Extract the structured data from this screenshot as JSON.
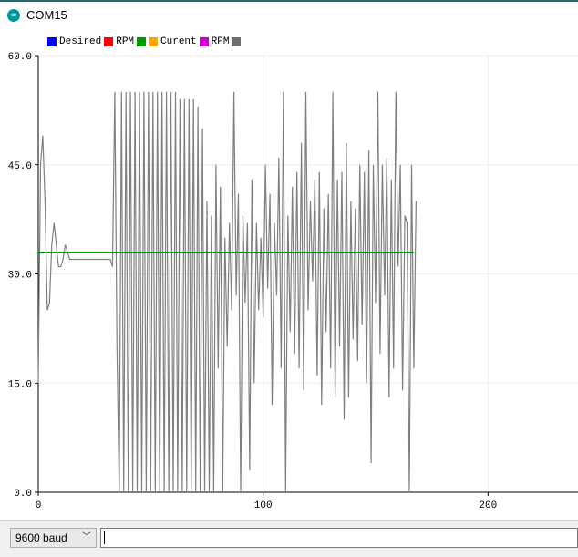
{
  "window": {
    "title": "COM15",
    "icon": "arduino-infinity-icon"
  },
  "legend": [
    {
      "label": "Desired",
      "color": "#0000ff"
    },
    {
      "label": "RPM",
      "color": "#ff0000"
    },
    {
      "label": "Curent",
      "color": "#009900"
    },
    {
      "label": "RPM",
      "color": "#cc00cc"
    },
    {
      "label": "",
      "color": "#ffa500"
    },
    {
      "label": "",
      "color": "#6e6e6e"
    }
  ],
  "chart_data": {
    "type": "line",
    "x_ticks": [
      "0",
      "100",
      "200"
    ],
    "y_ticks": [
      "0.0",
      "15.0",
      "30.0",
      "45.0",
      "60.0"
    ],
    "xlim": [
      0,
      240
    ],
    "ylim": [
      0,
      60
    ],
    "grid": true,
    "series": [
      {
        "color": "#808080",
        "x_start": 0,
        "values": [
          15,
          45,
          49,
          40,
          25,
          26,
          34,
          37,
          34,
          31,
          31,
          32,
          34,
          33,
          32,
          32,
          32,
          32,
          32,
          32,
          32,
          32,
          32,
          32,
          32,
          32,
          32,
          32,
          32,
          32,
          32,
          32,
          32,
          31,
          55,
          20,
          0,
          55,
          0,
          55,
          0,
          55,
          0,
          55,
          0,
          55,
          0,
          55,
          0,
          55,
          0,
          55,
          0,
          55,
          0,
          55,
          0,
          55,
          0,
          55,
          0,
          55,
          0,
          54,
          0,
          54,
          0,
          54,
          0,
          54,
          0,
          53,
          0,
          50,
          0,
          40,
          0,
          38,
          0,
          45,
          17,
          42,
          0,
          35,
          20,
          37,
          25,
          55,
          27,
          41,
          0,
          38,
          26,
          37,
          3,
          43,
          15,
          37,
          25,
          35,
          24,
          45,
          28,
          41,
          12,
          37,
          27,
          46,
          17,
          55,
          0,
          38,
          22,
          42,
          19,
          44,
          17,
          48,
          14,
          55,
          25,
          40,
          29,
          43,
          16,
          44,
          12,
          39,
          22,
          41,
          17,
          55,
          13,
          43,
          20,
          44,
          10,
          48,
          13,
          40,
          21,
          39,
          18,
          45,
          23,
          44,
          15,
          47,
          4,
          45,
          26,
          55,
          19,
          45,
          27,
          46,
          13,
          43,
          17,
          55,
          31,
          45,
          14,
          38,
          37,
          0,
          45,
          17,
          40
        ]
      },
      {
        "color": "#009900",
        "x_start": 0,
        "values_constant": 33,
        "x_end": 167
      }
    ]
  },
  "bottom": {
    "baud_label": "9600 baud",
    "input_value": ""
  }
}
